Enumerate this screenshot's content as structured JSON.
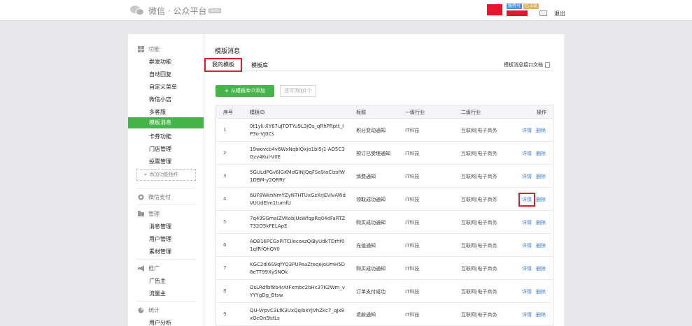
{
  "header": {
    "logo_text": "微信 · 公众平台",
    "logo_badge": "beta",
    "tags": [
      "服务号",
      "已认证"
    ],
    "logout": "退出"
  },
  "sidebar": {
    "groups": [
      {
        "label": "功能",
        "items": [
          "群发功能",
          "自动回复",
          "自定义菜单",
          "微信小店",
          "多客服",
          "模板消息",
          "卡券功能",
          "门店管理",
          "投票管理"
        ]
      },
      {
        "label": "微信支付",
        "items": []
      },
      {
        "label": "管理",
        "items": [
          "消息管理",
          "用户管理",
          "素材管理"
        ]
      },
      {
        "label": "推广",
        "items": [
          "广告主",
          "流量主"
        ]
      },
      {
        "label": "统计",
        "items": [
          "用户分析"
        ]
      }
    ],
    "add_plugin": "+ 添加功能插件",
    "active_item": "模板消息"
  },
  "main": {
    "title": "模版消息",
    "tabs": [
      {
        "label": "我的模板"
      },
      {
        "label": "模板库"
      }
    ],
    "doc_link": "模板消息接口文档",
    "add_button": "从模板库中添加",
    "remaining": "还可添加1个",
    "columns": [
      "序号",
      "模板ID",
      "标题",
      "一级行业",
      "二级行业",
      "操作"
    ],
    "action_detail": "详情",
    "action_delete": "删除",
    "rows": [
      {
        "no": "1",
        "id": "0t1yk-XY67uJTOTYu9L3jQs_qRhPRptt_IP3o-VJ0Cs",
        "title": "积分变动通知",
        "ind1": "IT科技",
        "ind2": "互联网|电子商务"
      },
      {
        "no": "2",
        "id": "19wovcb4v6WxNqbIQxjo1bI5j1-AO5C3Gzv4Kul-V0E",
        "title": "预订已受理通知",
        "ind1": "IT科技",
        "ind2": "互联网|电子商务"
      },
      {
        "no": "3",
        "id": "5GULdPGv6IGKMdGINJQqFSe9IoCizsfW1DBM-y2QRRY",
        "title": "消费通知",
        "ind1": "IT科技",
        "ind2": "互联网|电子商务"
      },
      {
        "no": "4",
        "id": "6UF8WkhNmYZyNTHTUxGzXrJEVlvAWdVUUdEIm1tumfU",
        "title": "领取成功通知",
        "ind1": "IT科技",
        "ind2": "互联网|电子商务"
      },
      {
        "no": "5",
        "id": "7q49SGmaIZVKobjUsWfqpRq04dFaRTZ732O5kFELApE",
        "title": "购买成功通知",
        "ind1": "IT科技",
        "ind2": "互联网|电子商务"
      },
      {
        "no": "6",
        "id": "AOB16PCGxPITCIlecoxzQiByUdkTDrhf01qfRfQhQY0",
        "title": "充值通知",
        "ind1": "IT科技",
        "ind2": "互联网|电子商务"
      },
      {
        "no": "7",
        "id": "KGC2dl6S9qfYQ3PUPeaZteqejoUmH5D8eTT99XySNOk",
        "title": "购买成功通知",
        "ind1": "IT科技",
        "ind2": "互联网|电子商务"
      },
      {
        "no": "8",
        "id": "OsLRdfbf8b4rAtFxmbc2bHc37K2Wm_vYYYgDg_Btsw",
        "title": "订单支付成功",
        "ind1": "IT科技",
        "ind2": "互联网|电子商务"
      },
      {
        "no": "9",
        "id": "QU-VrpvC3LfK3UxQqIbxYJVhZkc7_qJx8xOcOn5tdLs",
        "title": "退款通知",
        "ind1": "IT科技",
        "ind2": "互联网|电子商务"
      }
    ]
  },
  "colors": {
    "accent": "#44b549",
    "highlight": "#e8162c",
    "link": "#3b7ac9"
  }
}
